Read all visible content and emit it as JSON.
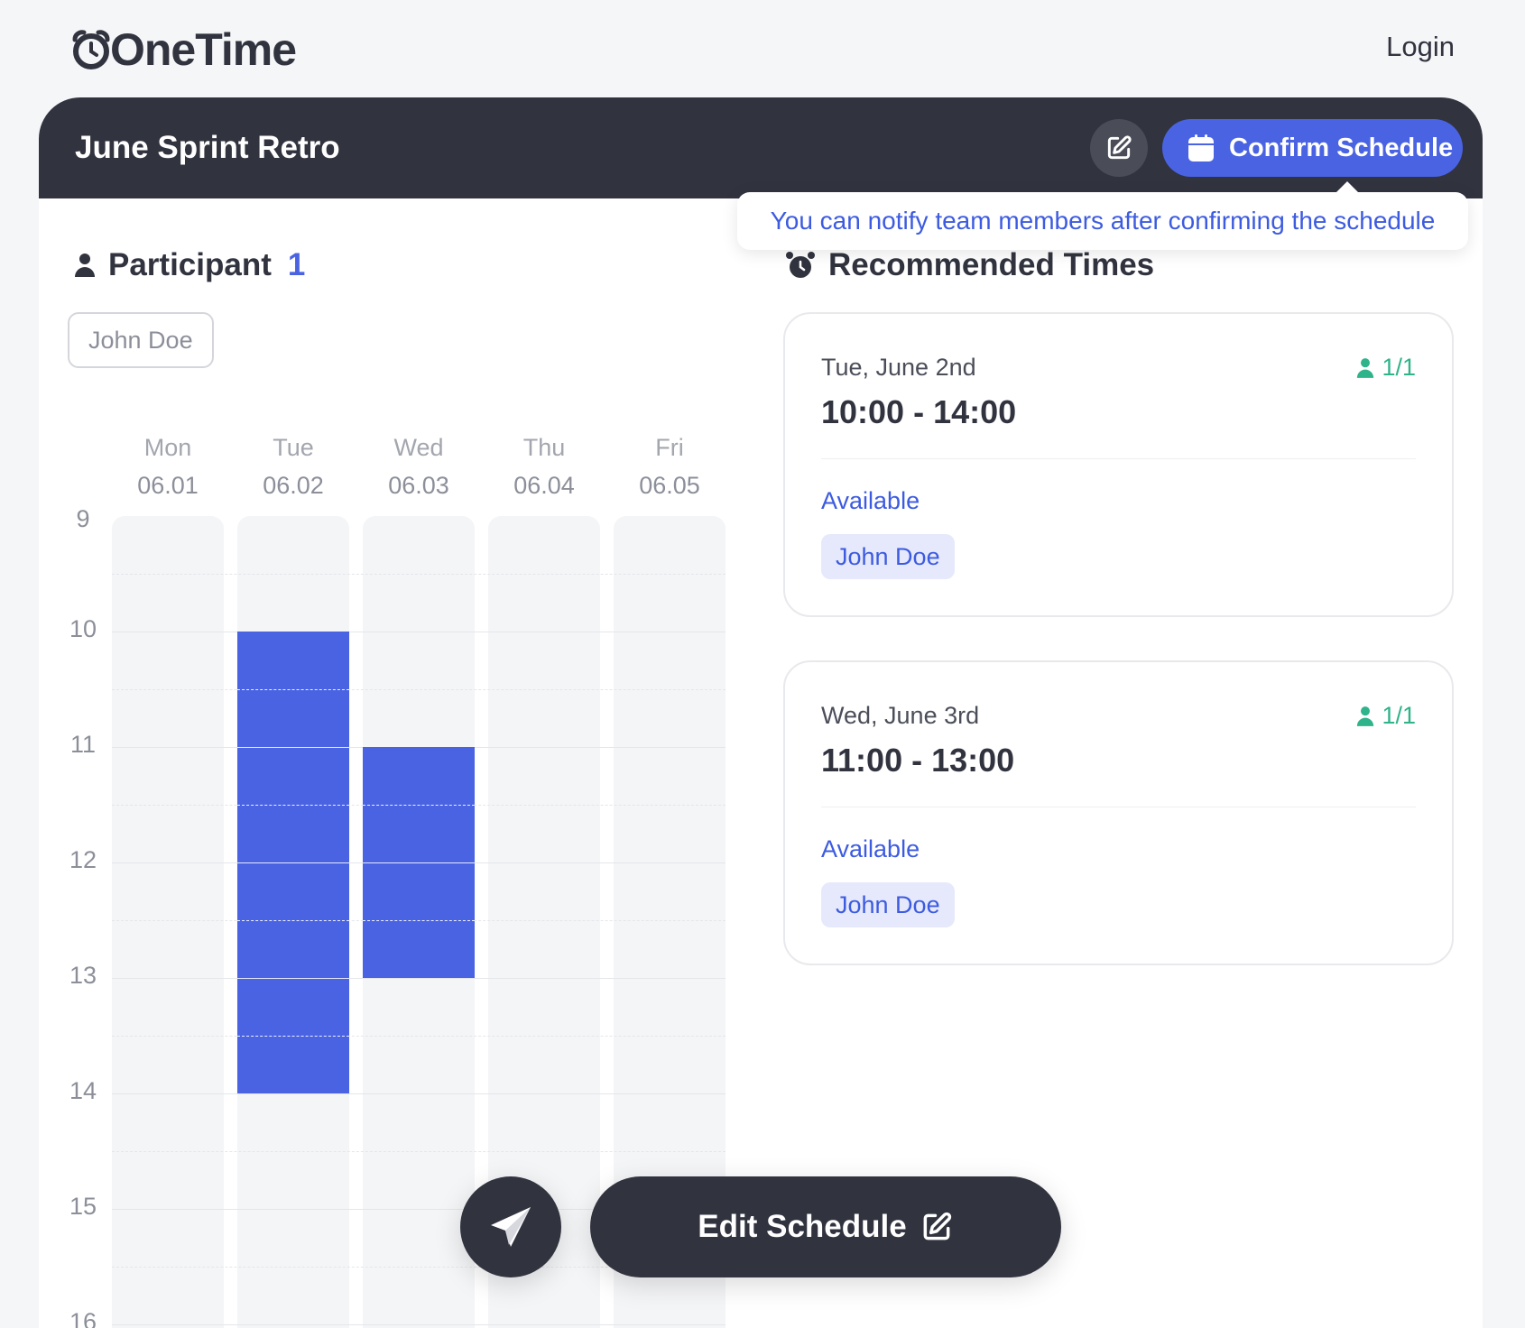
{
  "app": {
    "name": "OneTime",
    "login_label": "Login"
  },
  "event": {
    "title": "June Sprint Retro"
  },
  "toolbar": {
    "edit_icon": "pencil-square-icon",
    "confirm_label": "Confirm Schedule",
    "confirm_icon": "calendar-icon"
  },
  "tooltip": {
    "text": "You can notify team members after confirming the schedule"
  },
  "participants": {
    "title": "Participant",
    "count": "1",
    "names": [
      "John Doe"
    ]
  },
  "schedule": {
    "days": [
      {
        "label": "Mon",
        "date": "06.01"
      },
      {
        "label": "Tue",
        "date": "06.02"
      },
      {
        "label": "Wed",
        "date": "06.03"
      },
      {
        "label": "Thu",
        "date": "06.04"
      },
      {
        "label": "Fri",
        "date": "06.05"
      }
    ],
    "hours": [
      "9",
      "10",
      "11",
      "12",
      "13",
      "14",
      "15",
      "16"
    ],
    "availability": [
      {
        "day": "Tue",
        "start": "10:00",
        "end": "14:00"
      },
      {
        "day": "Wed",
        "start": "11:00",
        "end": "13:00"
      }
    ]
  },
  "recommended": {
    "title": "Recommended Times",
    "items": [
      {
        "date": "Tue, June 2nd",
        "time": "10:00 - 14:00",
        "count": "1/1",
        "available_label": "Available",
        "people": [
          "John Doe"
        ]
      },
      {
        "date": "Wed, June 3rd",
        "time": "11:00 - 13:00",
        "count": "1/1",
        "available_label": "Available",
        "people": [
          "John Doe"
        ]
      }
    ]
  },
  "actions": {
    "send_icon": "paper-plane-icon",
    "edit_label": "Edit Schedule",
    "edit_icon": "pencil-square-icon"
  },
  "colors": {
    "primary": "#4a63e2",
    "dark": "#31333f",
    "success": "#2fb38a",
    "background": "#f5f6f8"
  }
}
